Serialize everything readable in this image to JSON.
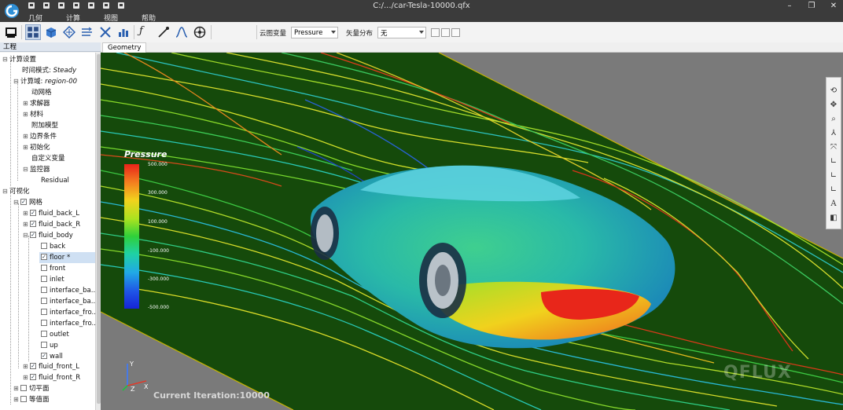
{
  "window": {
    "title": "C:/.../car-Tesla-10000.qfx",
    "controls": [
      "–",
      "❐",
      "✕"
    ]
  },
  "menu": [
    "几何",
    "计算",
    "视图",
    "帮助"
  ],
  "toolbar": {
    "field_variable_label": "云图变量",
    "field_variable_value": "Pressure",
    "vector_label": "矢量分布",
    "vector_value": "无"
  },
  "panel": {
    "title": "工程"
  },
  "tree": {
    "calc_settings": "计算设置",
    "time_mode_label": "时间模式:",
    "time_mode_value": "Steady",
    "domain_label": "计算域:",
    "domain_value": "region-00",
    "moving_mesh": "动网格",
    "solver": "求解器",
    "material": "材料",
    "extra_model": "附加模型",
    "boundary": "边界条件",
    "initialization": "初始化",
    "custom_var": "自定义变量",
    "monitor": "监控器",
    "residual": "Residual",
    "visualization": "可视化",
    "mesh": "网格",
    "fluid_back_L": "fluid_back_L",
    "fluid_back_R": "fluid_back_R",
    "fluid_body": "fluid_body",
    "back": "back",
    "floor": "floor *",
    "front": "front",
    "inlet": "inlet",
    "interface_ba1": "interface_ba...",
    "interface_ba2": "interface_ba...",
    "interface_fro1": "interface_fro...",
    "interface_fro2": "interface_fro...",
    "outlet": "outlet",
    "up": "up",
    "wall": "wall",
    "fluid_front_L": "fluid_front_L",
    "fluid_front_R": "fluid_front_R",
    "cut_plane": "切平面",
    "iso_surface": "等值面"
  },
  "viewport": {
    "tab": "Geometry",
    "legend_title": "Pressure",
    "legend_ticks": [
      "500.000",
      "300.000",
      "100.000",
      "-100.000",
      "-300.000",
      "-500.000"
    ],
    "iteration": "Current Iteration:10000",
    "watermark": "QFLUX",
    "axes": {
      "y": "Y",
      "x": "X",
      "z": "Z"
    }
  },
  "side_tools": [
    "rotate-icon",
    "pan-icon",
    "zoom-icon",
    "view-iso-icon",
    "fit-icon",
    "view-x-icon",
    "view-y-icon",
    "view-z-icon",
    "annotation-icon",
    "screenshot-icon"
  ],
  "colors": {
    "ground": "#154a0b",
    "titlebar": "#3b3b3b",
    "legend_high": "#e8231a",
    "legend_low": "#1624d6"
  }
}
